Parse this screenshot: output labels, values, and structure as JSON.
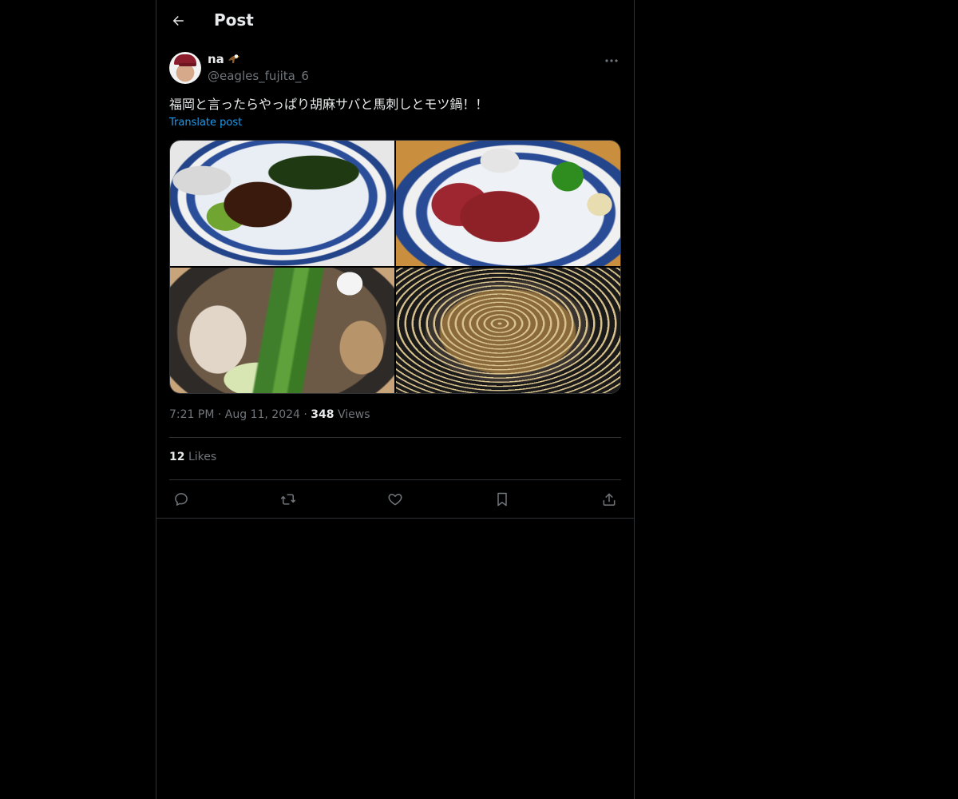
{
  "header": {
    "title": "Post"
  },
  "post": {
    "author": {
      "display_name": "na",
      "handle": "@eagles_fujita_6",
      "badge_icon": "eagle-emoji-icon"
    },
    "text": "福岡と言ったらやっぱり胡麻サバと馬刺しとモツ鍋！！",
    "translate_label": "Translate post",
    "media": [
      {
        "description_icon": "photo-goma-saba"
      },
      {
        "description_icon": "photo-basashi"
      },
      {
        "description_icon": "photo-motsunabe"
      },
      {
        "description_icon": "photo-noodle-soup"
      }
    ],
    "time": "7:21 PM",
    "date": "Aug 11, 2024",
    "views_count": "348",
    "views_label": "Views",
    "likes_count": "12",
    "likes_label": "Likes"
  },
  "colors": {
    "background": "#000000",
    "text_primary": "#e7e9ea",
    "text_secondary": "#71767b",
    "link": "#1d9bf0",
    "border": "#2f3336"
  }
}
